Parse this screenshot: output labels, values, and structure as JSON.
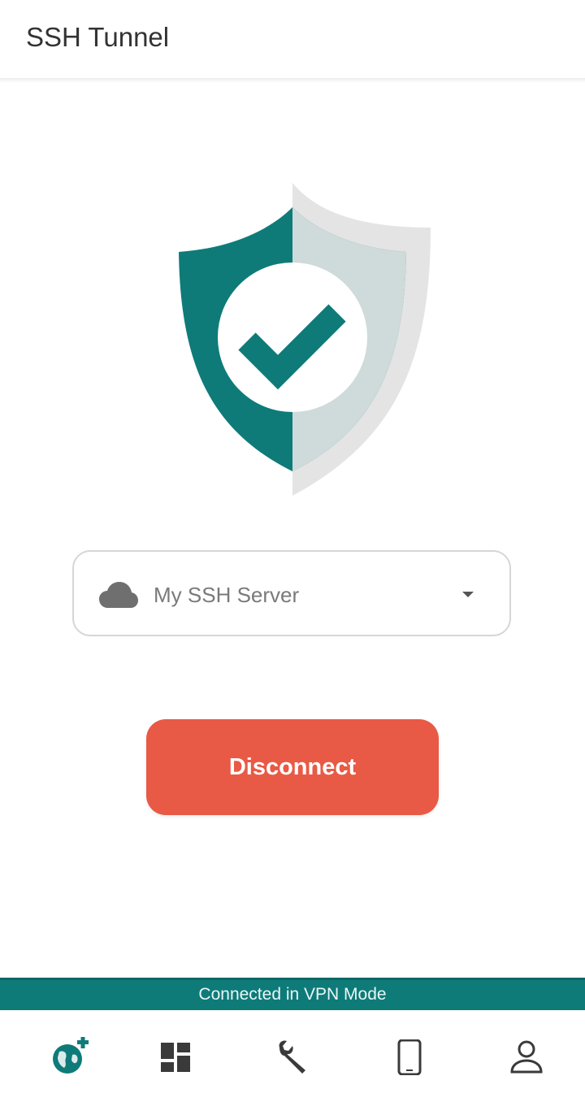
{
  "app": {
    "title": "SSH Tunnel"
  },
  "colors": {
    "accent": "#0e7b79",
    "disconnect": "#e85a45",
    "shield_shadow": "#e4e4e4"
  },
  "server_select": {
    "icon": "cloud-icon",
    "value": "My SSH Server",
    "dropdown_icon": "arrow-drop-down-icon"
  },
  "action": {
    "disconnect_label": "Disconnect"
  },
  "status": {
    "text": "Connected in VPN Mode"
  },
  "bottom_nav": {
    "items": [
      {
        "icon": "globe-add-icon",
        "active": true
      },
      {
        "icon": "dashboard-icon",
        "active": false
      },
      {
        "icon": "wrench-icon",
        "active": false
      },
      {
        "icon": "phone-icon",
        "active": false
      },
      {
        "icon": "account-icon",
        "active": false
      }
    ]
  }
}
